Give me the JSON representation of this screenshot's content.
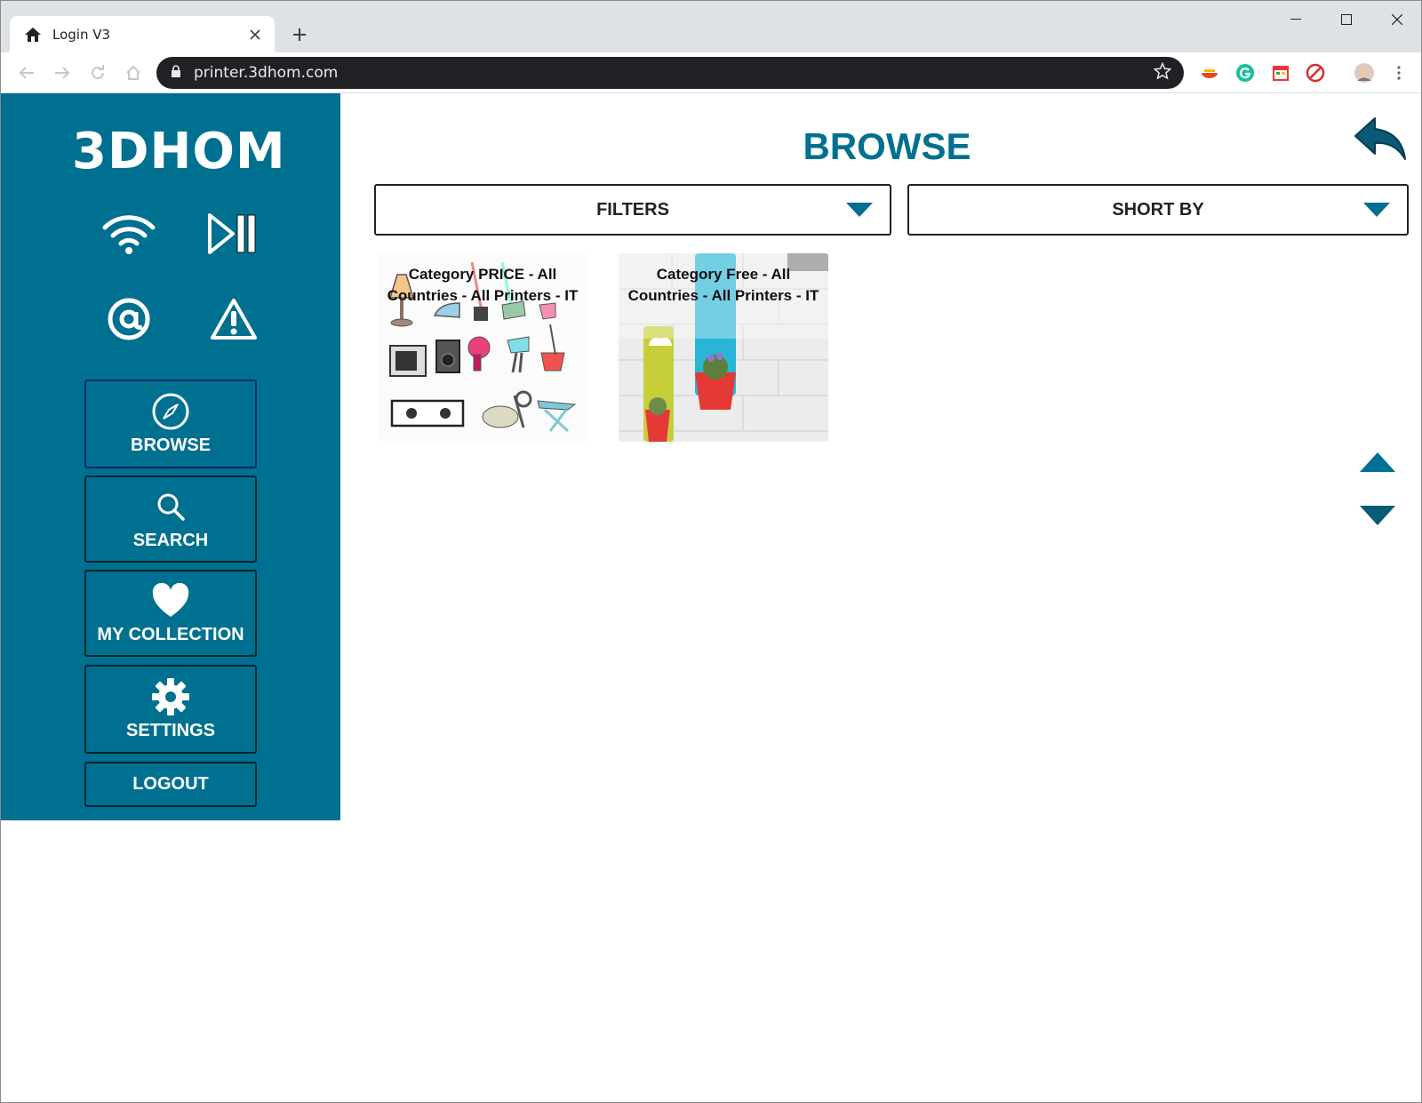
{
  "browser": {
    "tab_title": "Login V3",
    "url": "printer.3dhom.com"
  },
  "sidebar": {
    "logo_text": "3DHOM",
    "nav": [
      {
        "label": "BROWSE",
        "icon": "compass-icon"
      },
      {
        "label": "SEARCH",
        "icon": "search-icon"
      },
      {
        "label": "MY COLLECTION",
        "icon": "heart-icon"
      },
      {
        "label": "SETTINGS",
        "icon": "gear-icon"
      },
      {
        "label": "LOGOUT",
        "icon": ""
      }
    ]
  },
  "main": {
    "title": "BROWSE",
    "filters_label": "FILTERS",
    "sort_label": "SHORT BY",
    "cards": [
      {
        "title": "Category PRICE - All Countries - All Printers - IT"
      },
      {
        "title": "Category Free - All Countries - All Printers - IT"
      }
    ]
  },
  "colors": {
    "brand": "#007090",
    "tile_border": "#0a2530"
  }
}
